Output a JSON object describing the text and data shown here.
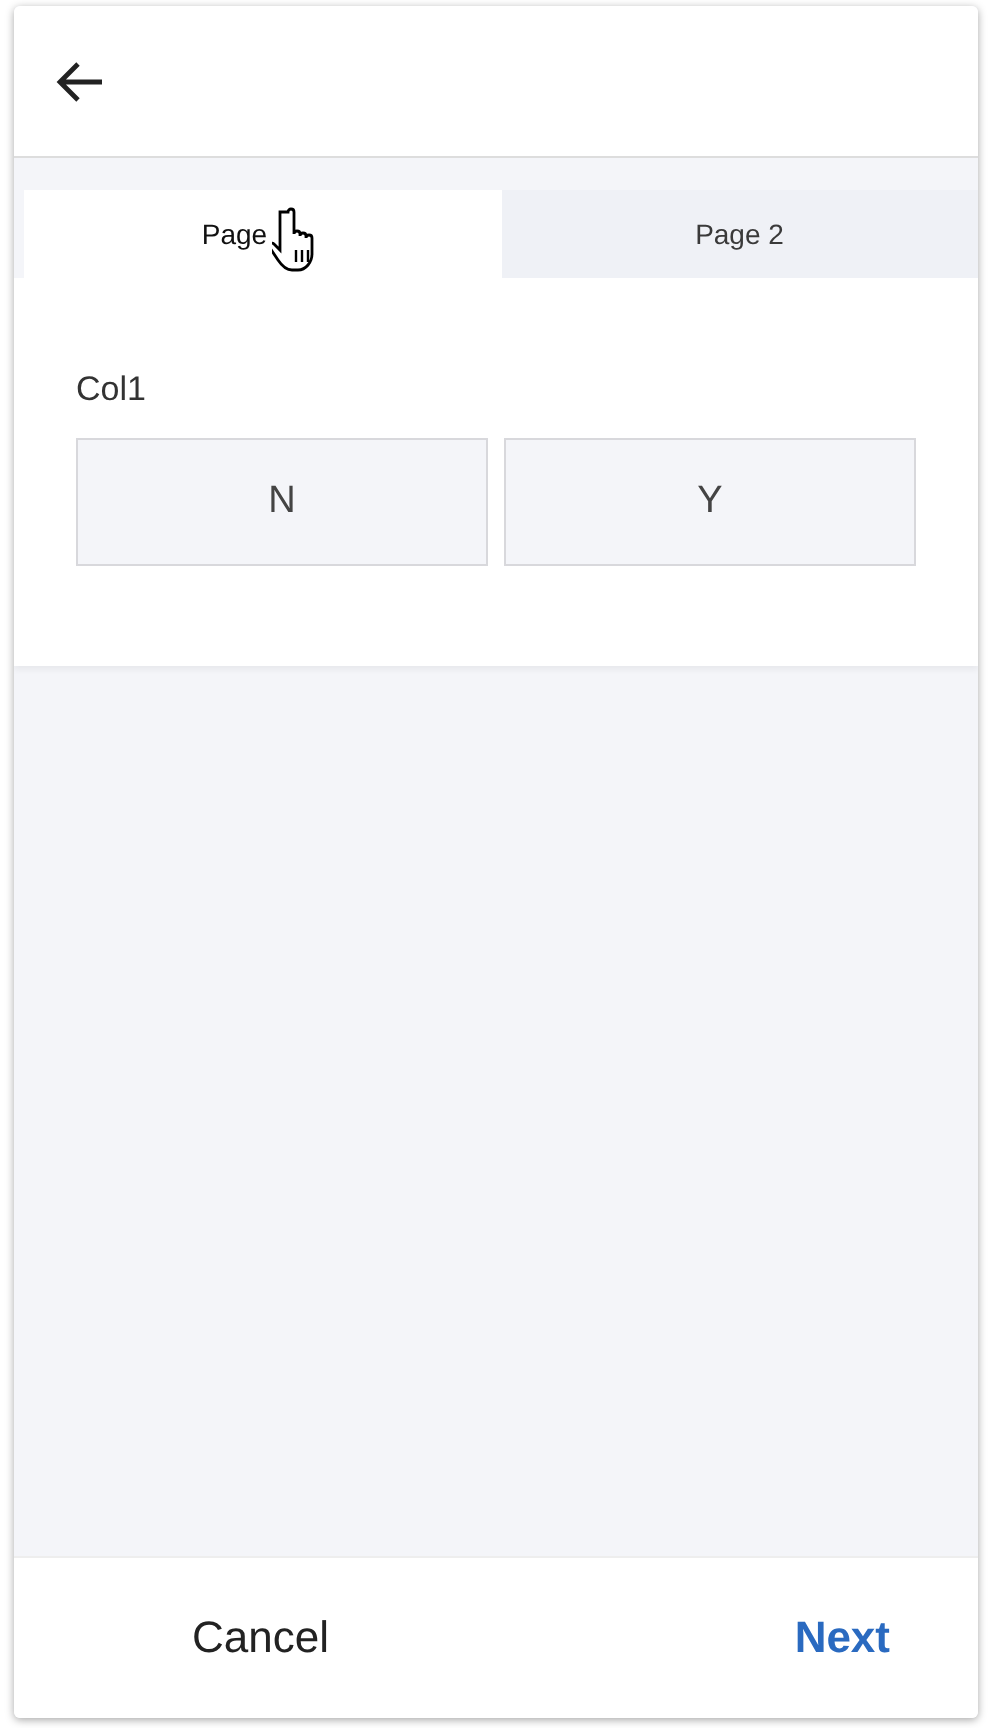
{
  "header": {
    "back_button": true
  },
  "tabs": [
    {
      "label": "Page",
      "selected": true,
      "cursor": true
    },
    {
      "label": "Page 2",
      "selected": false,
      "cursor": false
    }
  ],
  "field": {
    "label": "Col1",
    "options": [
      "N",
      "Y"
    ]
  },
  "footer": {
    "cancel": "Cancel",
    "next": "Next"
  }
}
